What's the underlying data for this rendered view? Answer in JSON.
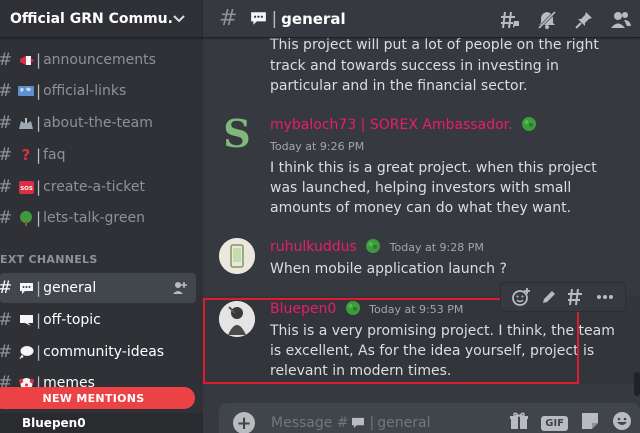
{
  "guild": {
    "name": "Official GRN Commu..."
  },
  "sidebar": {
    "channels": [
      {
        "name": "announcements",
        "emoji": "megaphone"
      },
      {
        "name": "official-links",
        "emoji": "world-map"
      },
      {
        "name": "about-the-team",
        "emoji": "stadium"
      },
      {
        "name": "faq",
        "emoji": "question-mark"
      },
      {
        "name": "create-a-ticket",
        "emoji": "sos"
      },
      {
        "name": "lets-talk-green",
        "emoji": "tree"
      }
    ],
    "category": "EXT CHANNELS",
    "text_channels": [
      {
        "name": "general",
        "emoji": "speech-balloon",
        "active": true
      },
      {
        "name": "off-topic",
        "emoji": "speech-left"
      },
      {
        "name": "community-ideas",
        "emoji": "thought-balloon"
      },
      {
        "name": "memes",
        "emoji": "clown-face"
      }
    ],
    "new_mentions": "NEW MENTIONS",
    "user": "Bluepen0"
  },
  "channel": {
    "name": "general"
  },
  "messages": [
    {
      "author": "",
      "lines": [
        "This project will put a lot of people on the right",
        "track and towards success in investing in",
        "particular and in the financial sector."
      ]
    },
    {
      "author": "mybaloch73 | SOREX Ambassador.",
      "author_color": "#e91e63",
      "timestamp": "Today at 9:26 PM",
      "lines": [
        "I think this is a great project. when this project",
        "was launched, helping investors with small",
        "amounts of money can do what they want."
      ]
    },
    {
      "author": "ruhulkuddus",
      "author_color": "#e91e63",
      "timestamp": "Today at 9:28 PM",
      "lines": [
        "When mobile application launch ?"
      ]
    },
    {
      "author": "Bluepen0",
      "author_color": "#e91e63",
      "timestamp": "Today at 9:53 PM",
      "lines": [
        "This is a very promising project. I think, the team",
        "is excellent, As for the idea yourself, project is",
        "relevant in modern times."
      ]
    }
  ],
  "composer": {
    "placeholder_prefix": "Message #",
    "placeholder_channel": "general",
    "gif_label": "GIF"
  },
  "colors": {
    "accent_red": "#ed4245",
    "highlight_box": "#e01b2f",
    "username_pink": "#e91e63"
  }
}
